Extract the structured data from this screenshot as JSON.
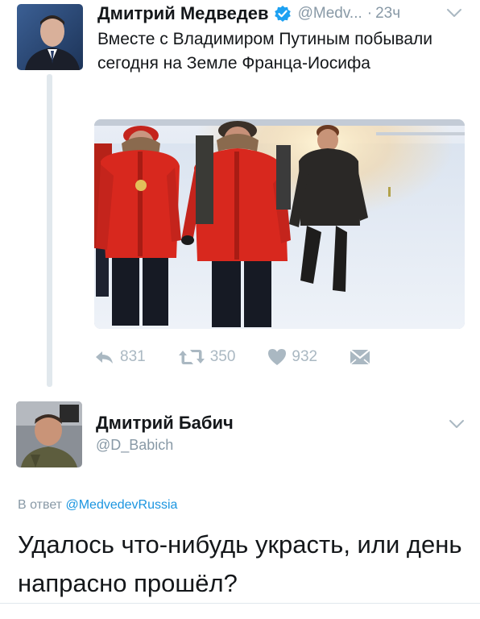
{
  "tweet": {
    "author_name": "Дмитрий Медведев",
    "handle": "@Medv...",
    "dot": "·",
    "time": "23ч",
    "text": "Вместе с Владимиром Путиным побывали сегодня на Земле Франца-Иосифа",
    "stats": {
      "replies": "831",
      "retweets": "350",
      "likes": "932"
    }
  },
  "reply": {
    "author_name": "Дмитрий Бабич",
    "handle": "@D_Babich",
    "reply_prefix": "В ответ",
    "reply_mention": "@MedvedevRussia",
    "text": "Удалось что-нибудь украсть, или день напрасно прошёл?"
  },
  "colors": {
    "verified": "#1da1f2",
    "muted": "#8899a6",
    "icon": "#aab8c2",
    "link": "#1b95e0",
    "jacket": "#d8281e"
  },
  "icons": [
    "verified-badge-icon",
    "chevron-down-icon",
    "reply-icon",
    "retweet-icon",
    "heart-icon",
    "dm-icon"
  ]
}
